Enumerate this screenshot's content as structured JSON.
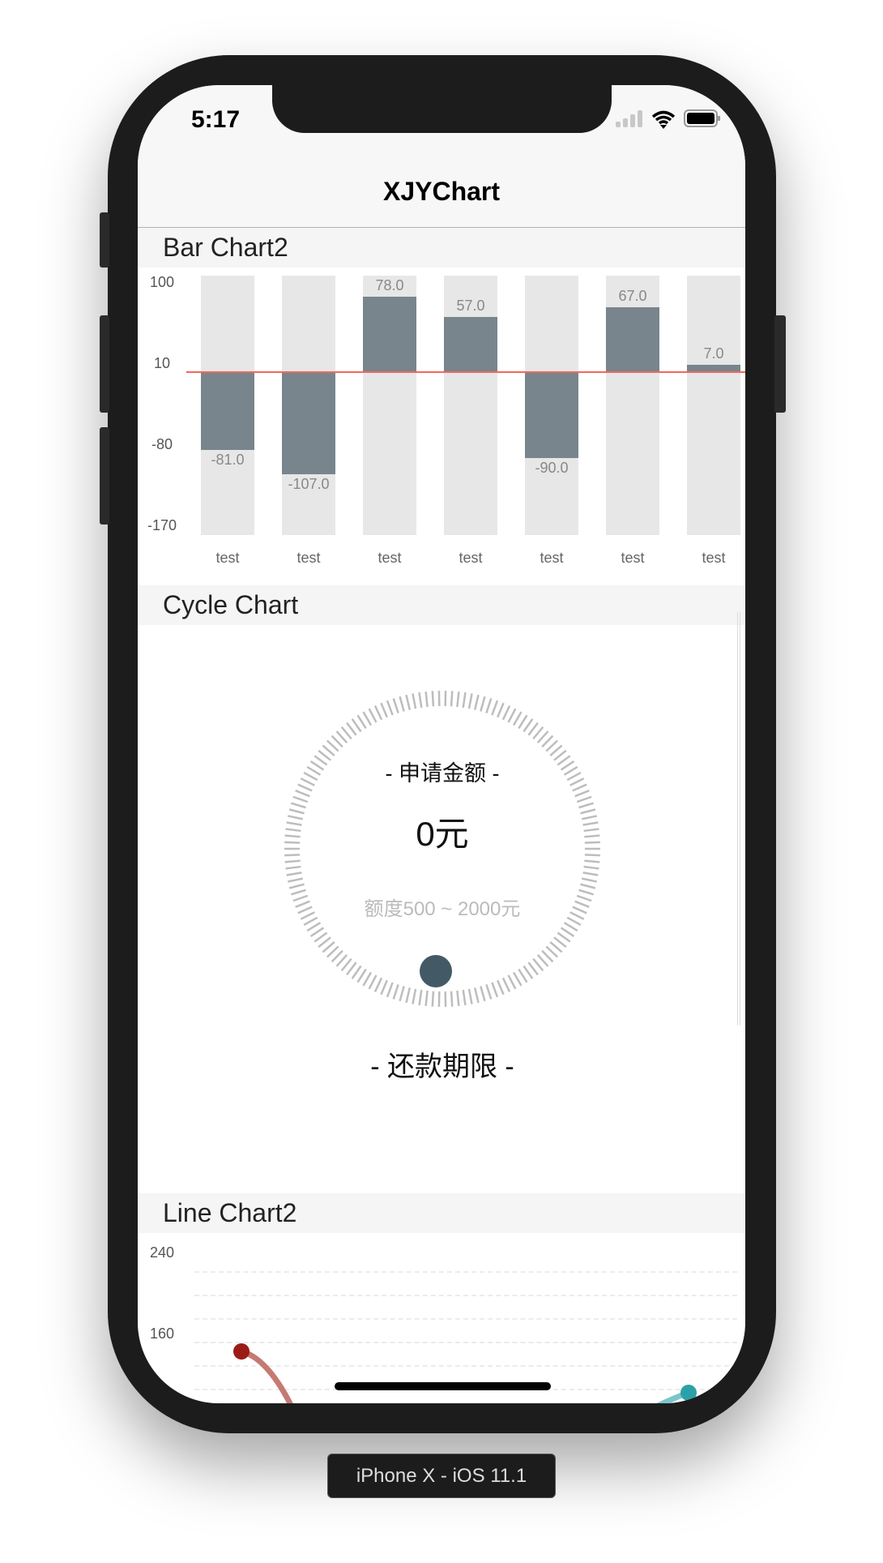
{
  "status": {
    "time": "5:17"
  },
  "nav": {
    "title": "XJYChart"
  },
  "sections": {
    "bar": "Bar Chart2",
    "cycle": "Cycle Chart",
    "line": "Line Chart2"
  },
  "cycle": {
    "title": "- 申请金额 -",
    "amount": "0元",
    "range": "额度500 ~ 2000元",
    "term": "- 还款期限 -",
    "knob_color": "#435a66"
  },
  "device_label": "iPhone X - iOS 11.1",
  "chart_data": [
    {
      "type": "bar",
      "title": "Bar Chart2",
      "categories": [
        "test",
        "test",
        "test",
        "test",
        "test",
        "test",
        "test"
      ],
      "values": [
        -81.0,
        -107.0,
        78.0,
        57.0,
        -90.0,
        67.0,
        7.0
      ],
      "value_labels": [
        "-81.0",
        "-107.0",
        "78.0",
        "57.0",
        "-90.0",
        "67.0",
        "7.0"
      ],
      "y_ticks": [
        "100",
        "10",
        "-80",
        "-170"
      ],
      "ylim": [
        -170,
        100
      ],
      "baseline": 0,
      "bar_color": "#78858d",
      "baseline_color": "#f0695a"
    },
    {
      "type": "line",
      "title": "Line Chart2",
      "y_ticks": [
        "240",
        "160"
      ],
      "series": [
        {
          "name": "red",
          "color": "#9b1c17",
          "first_value": 143
        },
        {
          "name": "teal",
          "color": "#2aa1a8",
          "value": 104
        }
      ]
    }
  ]
}
